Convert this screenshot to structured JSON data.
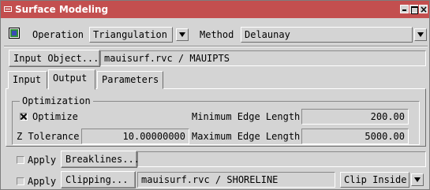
{
  "window": {
    "title": "Surface Modeling"
  },
  "toolbar": {
    "operation_label": "Operation",
    "operation_value": "Triangulation",
    "method_label": "Method",
    "method_value": "Delaunay"
  },
  "input_object": {
    "button_label": "Input Object...",
    "value": "mauisurf.rvc / MAUIPTS"
  },
  "tabs": [
    {
      "label": "Input",
      "active": false
    },
    {
      "label": "Output",
      "active": true
    },
    {
      "label": "Parameters",
      "active": false
    }
  ],
  "optimization": {
    "group_label": "Optimization",
    "optimize_label": "Optimize",
    "optimize_checked": true,
    "z_tolerance_label": "Z Tolerance",
    "z_tolerance_value": "10.00000000",
    "min_edge_label": "Minimum Edge Length",
    "min_edge_value": "200.00",
    "max_edge_label": "Maximum Edge Length",
    "max_edge_value": "5000.00"
  },
  "breaklines": {
    "apply_label": "Apply",
    "apply_checked": false,
    "button_label": "Breaklines...",
    "value": ""
  },
  "clipping": {
    "apply_label": "Apply",
    "apply_checked": false,
    "button_label": "Clipping...",
    "value": "mauisurf.rvc / SHORELINE",
    "mode_value": "Clip Inside"
  },
  "icons": [
    "window-menu-icon",
    "minimize-icon",
    "maximize-icon",
    "close-icon",
    "surface-modeling-icon",
    "dropdown-arrow-icon"
  ],
  "colors": {
    "titlebar": "#c34f4f",
    "background": "#d4d4d4"
  }
}
